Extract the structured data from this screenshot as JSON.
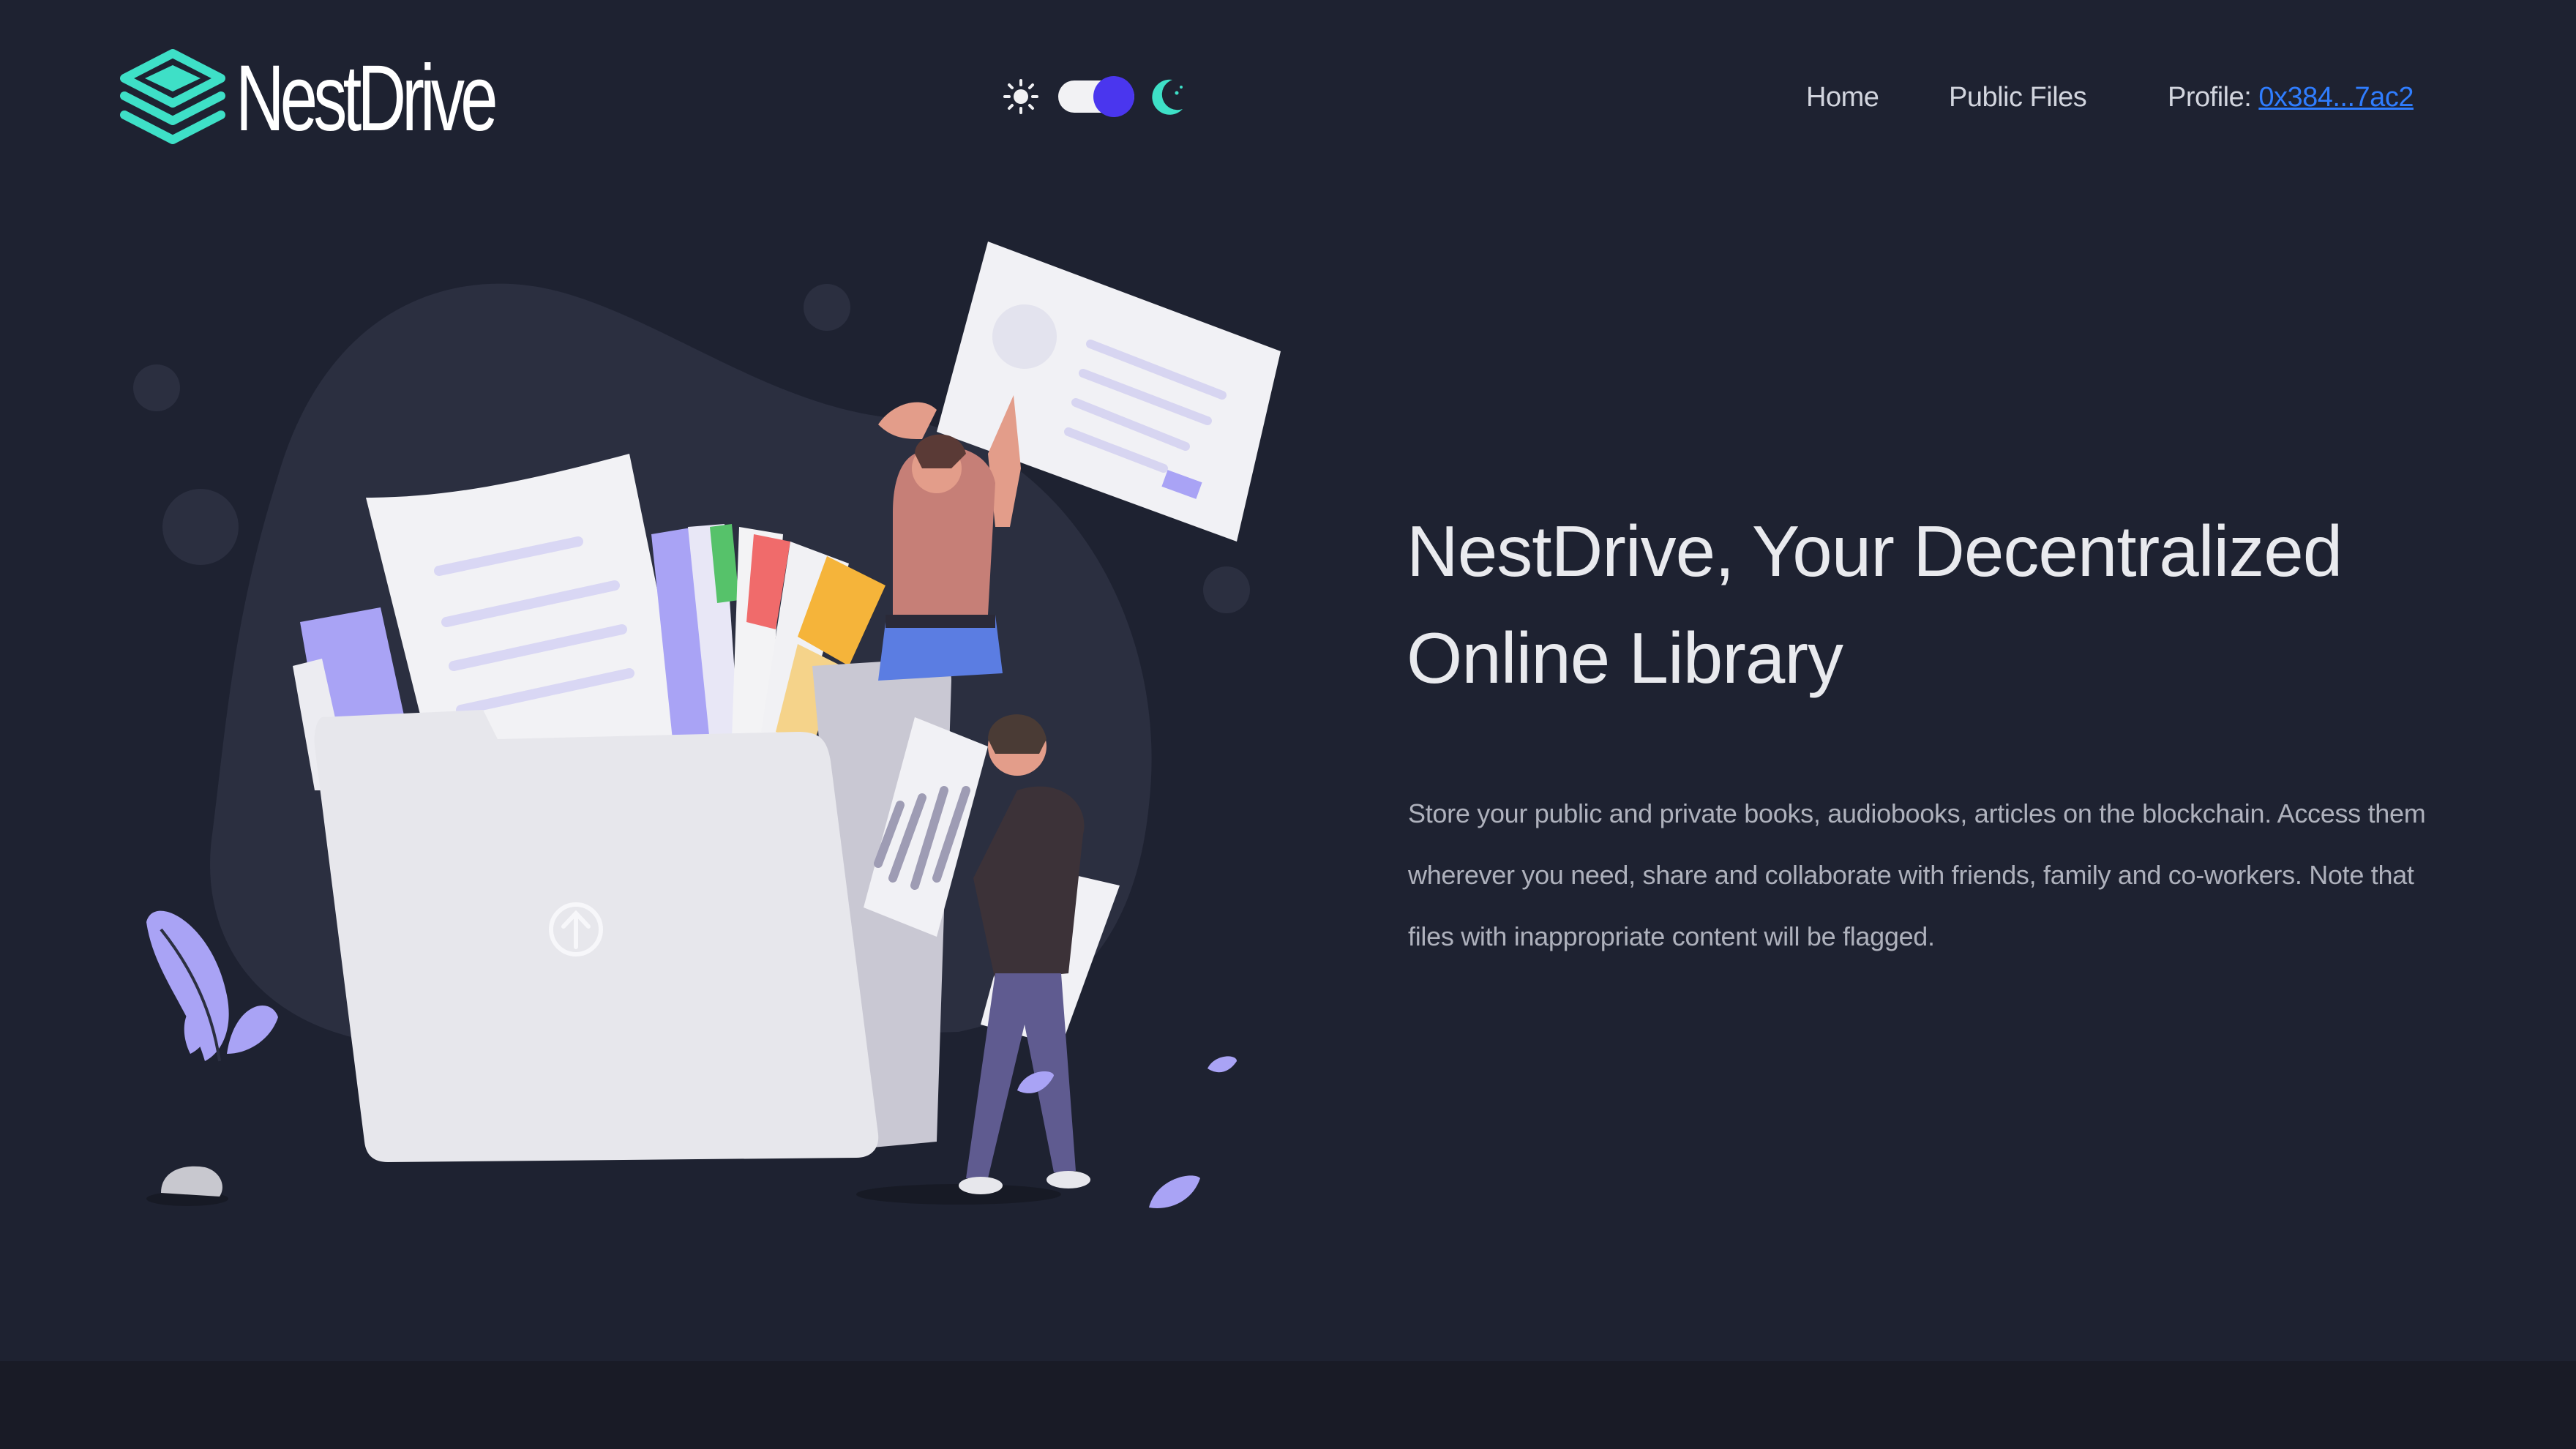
{
  "header": {
    "logo_text": "NestDrive",
    "logo_color": "#3ee0c7",
    "theme": {
      "sun_icon": "sun-icon",
      "moon_icon": "moon-icon",
      "toggle_state": "dark",
      "toggle_color": "#4a36ee"
    },
    "nav": {
      "home": "Home",
      "public_files": "Public Files",
      "profile_label": "Profile:",
      "profile_address": "0x384...7ac2"
    }
  },
  "hero": {
    "title": "NestDrive, Your Decentralized Online Library",
    "description": "Store your public and private books, audiobooks, articles on the blockchain. Access them wherever you need, share and collaborate with friends, family and co-workers. Note that files with inappropriate content will be flagged."
  },
  "colors": {
    "background": "#1e2231",
    "footer": "#191b26",
    "link": "#2f7dff",
    "illustration_accent": "#a9a3f5"
  }
}
